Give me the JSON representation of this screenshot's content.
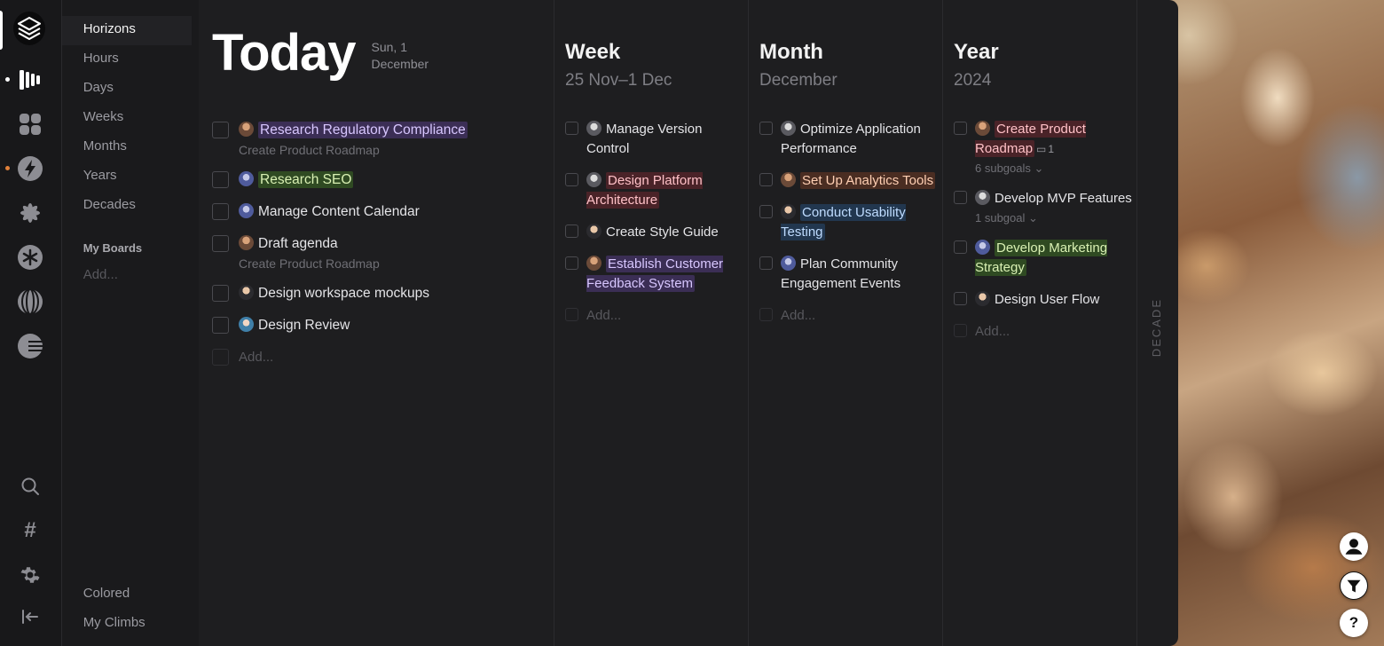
{
  "colors": {
    "accent": "#ffffff",
    "dot_white": "#ffffff",
    "dot_orange": "#e0803a"
  },
  "rail": {
    "top_icons": [
      "logo-layers-icon",
      "horizons-bars-icon",
      "grid-blocks-icon",
      "lightning-icon",
      "flower-icon",
      "asterisk-icon",
      "globe-lines-icon",
      "half-moon-icon"
    ],
    "bottom_icons": [
      "search-icon",
      "hash-icon",
      "gear-icon",
      "collapse-sidebar-icon"
    ],
    "hash_glyph": "#"
  },
  "nav": {
    "items": [
      "Horizons",
      "Hours",
      "Days",
      "Weeks",
      "Months",
      "Years",
      "Decades"
    ],
    "boards_header": "My Boards",
    "boards_add": "Add...",
    "bottom_items": [
      "Colored",
      "My Climbs"
    ]
  },
  "today": {
    "title": "Today",
    "date_line1": "Sun, 1",
    "date_line2": "December",
    "tasks": [
      {
        "text": "Research Regulatory Compliance",
        "parent": "Create Product Roadmap"
      },
      {
        "text": "Research SEO"
      },
      {
        "text": "Manage Content Calendar"
      },
      {
        "text": "Draft agenda",
        "parent": "Create Product Roadmap"
      },
      {
        "text": "Design workspace mockups"
      },
      {
        "text": "Design Review"
      }
    ],
    "add": "Add..."
  },
  "week": {
    "title": "Week",
    "subtitle": "25 Nov–1 Dec",
    "tasks": [
      "Manage Version Control",
      "Design Platform Architecture",
      "Create Style Guide",
      "Establish Customer Feedback System"
    ],
    "add": "Add..."
  },
  "month": {
    "title": "Month",
    "subtitle": "December",
    "tasks": [
      "Optimize Application Performance",
      "Set Up Analytics Tools",
      "Conduct Usability Testing",
      "Plan Community Engagement Events"
    ],
    "add": "Add..."
  },
  "year": {
    "title": "Year",
    "subtitle": "2024",
    "tasks": [
      {
        "text": "Create Product Roadmap",
        "comments": "1",
        "subgoals": "6 subgoals ⌄"
      },
      {
        "text": "Develop MVP Features",
        "subgoals": "1 subgoal ⌄"
      },
      {
        "text": "Develop Marketing Strategy"
      },
      {
        "text": "Design User Flow"
      }
    ],
    "add": "Add..."
  },
  "decade": {
    "label": "DECADE"
  },
  "fab": {
    "help": "?"
  }
}
